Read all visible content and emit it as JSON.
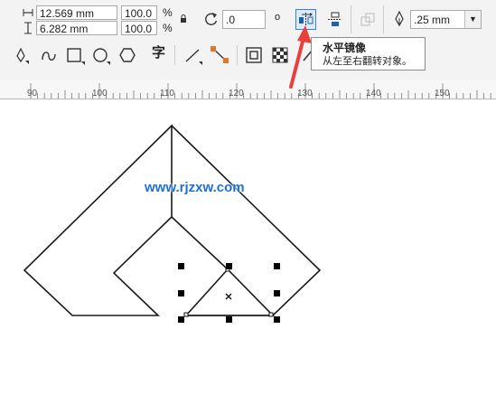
{
  "property_bar": {
    "width_value": "12.569 mm",
    "height_value": "6.282 mm",
    "scale_x": "100.0",
    "scale_y": "100.0",
    "percent_symbol": "%",
    "rotation_value": ".0",
    "degree_symbol": "o",
    "outline_width": ".25 mm"
  },
  "tooltip": {
    "title": "水平镜像",
    "description": "从左至右翻转对象。"
  },
  "toolbar": {
    "text_tool_glyph": "字"
  },
  "ruler": {
    "ticks": [
      "90",
      "100",
      "110",
      "120",
      "130",
      "140",
      "150"
    ]
  },
  "watermark": "www.rjzxw.com",
  "colors": {
    "selected_button_border": "#3b7fd8",
    "arrow": "#e8413b",
    "watermark": "#1f6fd6"
  }
}
